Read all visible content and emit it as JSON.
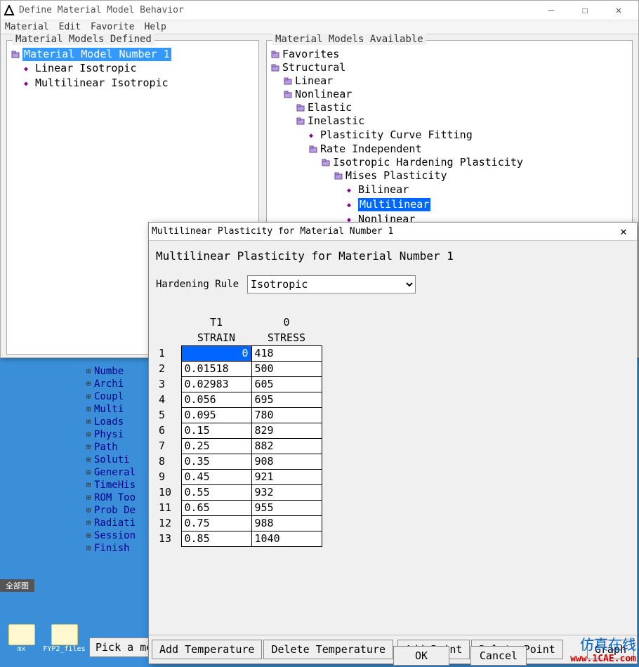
{
  "main_window": {
    "title": "Define Material Model Behavior",
    "menu": [
      "Material",
      "Edit",
      "Favorite",
      "Help"
    ],
    "minimize": "—",
    "maximize": "☐",
    "close": "✕"
  },
  "defined": {
    "legend": "Material Models Defined",
    "items": [
      {
        "label": "Material Model Number 1",
        "type": "folder",
        "indent": 0,
        "selected": true
      },
      {
        "label": "Linear Isotropic",
        "type": "leaf",
        "indent": 1
      },
      {
        "label": "Multilinear Isotropic",
        "type": "leaf",
        "indent": 1
      }
    ]
  },
  "available": {
    "legend": "Material Models Available",
    "items": [
      {
        "label": "Favorites",
        "type": "folder",
        "indent": 0
      },
      {
        "label": "Structural",
        "type": "folder",
        "indent": 0
      },
      {
        "label": "Linear",
        "type": "folder",
        "indent": 1
      },
      {
        "label": "Nonlinear",
        "type": "folder",
        "indent": 1
      },
      {
        "label": "Elastic",
        "type": "folder",
        "indent": 2
      },
      {
        "label": "Inelastic",
        "type": "folder",
        "indent": 2
      },
      {
        "label": "Plasticity Curve Fitting",
        "type": "leaf",
        "indent": 3
      },
      {
        "label": "Rate Independent",
        "type": "folder",
        "indent": 3
      },
      {
        "label": "Isotropic Hardening Plasticity",
        "type": "folder",
        "indent": 4
      },
      {
        "label": "Mises Plasticity",
        "type": "folder",
        "indent": 5
      },
      {
        "label": "Bilinear",
        "type": "leaf",
        "indent": 6
      },
      {
        "label": "Multilinear",
        "type": "leaf",
        "indent": 6,
        "selected": true
      },
      {
        "label": "Nonlinear",
        "type": "leaf",
        "indent": 6
      }
    ]
  },
  "dialog": {
    "title": "Multilinear Plasticity for Material Number 1",
    "heading": "Multilinear Plasticity for Material Number 1",
    "rule_label": "Hardening Rule",
    "rule_value": "Isotropic",
    "close": "✕",
    "t_label": "T1",
    "t_value": "0",
    "col_strain": "STRAIN",
    "col_stress": "STRESS",
    "rows": [
      {
        "n": "1",
        "strain": "0",
        "stress": "418",
        "selected": true
      },
      {
        "n": "2",
        "strain": "0.01518",
        "stress": "500"
      },
      {
        "n": "3",
        "strain": "0.02983",
        "stress": "605"
      },
      {
        "n": "4",
        "strain": "0.056",
        "stress": "695"
      },
      {
        "n": "5",
        "strain": "0.095",
        "stress": "780"
      },
      {
        "n": "6",
        "strain": "0.15",
        "stress": "829"
      },
      {
        "n": "7",
        "strain": "0.25",
        "stress": "882"
      },
      {
        "n": "8",
        "strain": "0.35",
        "stress": "908"
      },
      {
        "n": "9",
        "strain": "0.45",
        "stress": "921"
      },
      {
        "n": "10",
        "strain": "0.55",
        "stress": "932"
      },
      {
        "n": "11",
        "strain": "0.65",
        "stress": "955"
      },
      {
        "n": "12",
        "strain": "0.75",
        "stress": "988"
      },
      {
        "n": "13",
        "strain": "0.85",
        "stress": "1040"
      }
    ],
    "buttons": {
      "add_temp": "Add Temperature",
      "del_temp": "Delete Temperature",
      "add_point": "Add Point",
      "del_point": "Delete Point",
      "graph": "Graph",
      "ok": "OK",
      "cancel": "Cancel"
    }
  },
  "bg_tree": [
    "Numbe",
    "Archi",
    "Coupl",
    "Multi",
    "Loads",
    "Physi",
    "Path",
    "Soluti",
    "General",
    "TimeHis",
    "ROM Too",
    "Prob De",
    "Radiati",
    "Session",
    "Finish"
  ],
  "bg_tree_label": "全部图",
  "pick_label": "Pick a me",
  "desktop": {
    "icon1": "mx",
    "icon2": "FYP2_files"
  },
  "watermark": {
    "line1": "仿真在线",
    "line2": "www.1CAE.com"
  },
  "cae_wm": "1CAE.COM"
}
